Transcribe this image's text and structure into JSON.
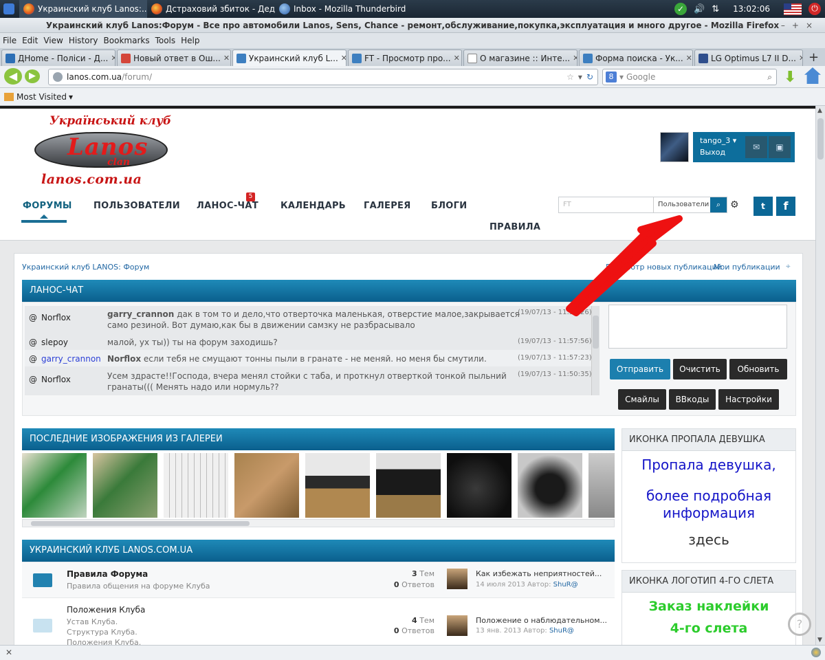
{
  "taskbar": {
    "items": [
      {
        "label": "Украинский клуб Lanos:..."
      },
      {
        "label": "Дстраховий збиток - Деда..."
      },
      {
        "label": "Inbox - Mozilla Thunderbird"
      }
    ],
    "clock": "13:02:06"
  },
  "window": {
    "title": "Украинский клуб Lanos:Форум - Все про автомобили Lanos, Sens, Chance - ремонт,обслуживание,покупка,эксплуатация и много другое - Mozilla Firefox"
  },
  "menu": [
    "File",
    "Edit",
    "View",
    "History",
    "Bookmarks",
    "Tools",
    "Help"
  ],
  "tabs": [
    {
      "label": "ДHome - Поліси - Д..."
    },
    {
      "label": "Новый ответ в Ош..."
    },
    {
      "label": "Украинский клуб L..."
    },
    {
      "label": "FT - Просмотр про..."
    },
    {
      "label": "О магазине :: Инте..."
    },
    {
      "label": "Форма поиска - Ук..."
    },
    {
      "label": "LG Optimus L7 II D..."
    }
  ],
  "address": {
    "host": "lanos.com.ua",
    "path": "/forum/"
  },
  "search_engine": {
    "placeholder": "Google"
  },
  "bookmarks": {
    "most_visited": "Most Visited"
  },
  "site": {
    "logo_top": "Український клуб",
    "logo_main": "Lanos",
    "logo_sub": "clan",
    "logo_url": "lanos.com.ua",
    "user": {
      "name": "tango_3",
      "logout": "Выход"
    },
    "nav": {
      "forums": "ФОРУМЫ",
      "users": "ПОЛЬЗОВАТЕЛИ",
      "chat": "ЛАНОС-ЧАТ",
      "chat_badge": "5",
      "calendar": "КАЛЕНДАРЬ",
      "gallery": "ГАЛЕРЕЯ",
      "blogs": "БЛОГИ",
      "rules": "ПРАВИЛА"
    },
    "search": {
      "value": "FT",
      "scope": "Пользователи"
    }
  },
  "breadcrumb": {
    "home": "Украинский клуб LANOS: Форум",
    "new_posts": "Просмотр новых публикаций",
    "my_posts": "Мои публикации"
  },
  "chat": {
    "title": "ЛАНОС-ЧАТ",
    "messages": [
      {
        "user": "Norflox",
        "to": "garry_crannon",
        "text": "дак в том то и дело,что отверточка маленькая, отверстие малое,закрывается само резиной. Вот думаю,как бы в движении самзку не разбрасывало",
        "time": "(19/07/13 - 11:59:26)"
      },
      {
        "user": "slepoy",
        "to": "",
        "text": "малой, ух ты)) ты на форум заходишь?",
        "time": "(19/07/13 - 11:57:56)"
      },
      {
        "user": "garry_crannon",
        "to": "Norflox",
        "text": "если тебя не смущают тонны пыли в гранате - не меняй. но меня бы смутили.",
        "time": "(19/07/13 - 11:57:23)"
      },
      {
        "user": "Norflox",
        "to": "",
        "text": "Усем здрасте!!Господа, вчера менял стойки с таба, и проткнул отверткой тонкой пыльний гранаты((( Менять надо или нормуль??",
        "time": "(19/07/13 - 11:50:35)"
      }
    ],
    "buttons": {
      "send": "Отправить",
      "clear": "Очистить",
      "refresh": "Обновить",
      "smiles": "Смайлы",
      "bbcodes": "BBкоды",
      "settings": "Настройки"
    }
  },
  "gallery": {
    "title": "ПОСЛЕДНИЕ ИЗОБРАЖЕНИЯ ИЗ ГАЛЕРЕИ"
  },
  "forum": {
    "title": "УКРАИНСКИЙ КЛУБ LANOS.COM.UA",
    "rows": [
      {
        "name": "Правила Форума",
        "desc": "Правила общения на форуме Клуба",
        "topics": "3",
        "topics_label": "Тем",
        "replies": "0",
        "replies_label": "Ответов",
        "last_title": "Как избежать неприятностей...",
        "last_date": "14 июля 2013",
        "author_label": "Автор:",
        "author": "ShuR@"
      },
      {
        "name": "Положения Клуба",
        "desc": "Устав Клуба.",
        "desc2": "Структура Клуба.",
        "desc3": "Положения Клуба.",
        "topics": "4",
        "topics_label": "Тем",
        "replies": "0",
        "replies_label": "Ответов",
        "last_title": "Положение о наблюдательном...",
        "last_date": "13 янв. 2013",
        "author_label": "Автор:",
        "author": "ShuR@"
      }
    ]
  },
  "sidebar": {
    "box1": {
      "title": "ИКОНКА ПРОПАЛА ДЕВУШКА",
      "line1": "Пропала девушка,",
      "line2": "более подробная",
      "line3": "информация",
      "line4": "здесь"
    },
    "box2": {
      "title": "ИКОНКА ЛОГОТИП 4-ГО СЛЕТА",
      "line1": "Заказ наклейки",
      "line2": "4-го слета"
    }
  },
  "colors": {
    "accent": "#0a6f9e",
    "link": "#2167a3",
    "chat_send": "#1c7fae",
    "missing_text": "#1414c8",
    "order_text": "#2ccc2c"
  }
}
